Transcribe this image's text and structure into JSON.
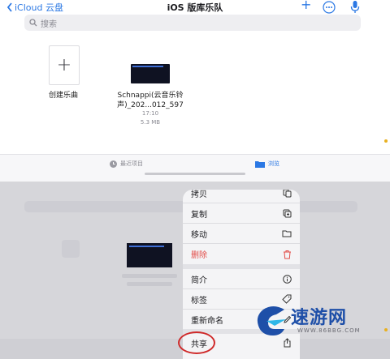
{
  "top": {
    "back_label": "iCloud 云盘",
    "title": "iOS 版库乐队",
    "search_placeholder": "搜索",
    "new_item_label": "创建乐曲",
    "file": {
      "name_line1": "Schnappi(云音乐铃",
      "name_line2": "声)_202...012_597",
      "time": "17:10",
      "size": "5.3 MB"
    },
    "tabs": [
      {
        "label": "最近项目",
        "icon": "clock-icon"
      },
      {
        "label": "浏览",
        "icon": "folder-icon"
      }
    ]
  },
  "menu": {
    "items": [
      {
        "label": "拷贝",
        "icon": "copy-icon"
      },
      {
        "label": "复制",
        "icon": "duplicate-icon"
      },
      {
        "label": "移动",
        "icon": "folder-icon"
      },
      {
        "label": "删除",
        "icon": "trash-icon",
        "destructive": true
      },
      {
        "label": "简介",
        "icon": "info-icon"
      },
      {
        "label": "标签",
        "icon": "tag-icon"
      },
      {
        "label": "重新命名",
        "icon": "pencil-icon"
      },
      {
        "label": "共享",
        "icon": "share-icon"
      }
    ]
  },
  "watermark": {
    "brand": "速游网",
    "url": "WWW.86BBG.COM"
  },
  "colors": {
    "accent": "#2b78e4",
    "destructive": "#e24b47",
    "highlight_circle": "#cf2a2a"
  }
}
